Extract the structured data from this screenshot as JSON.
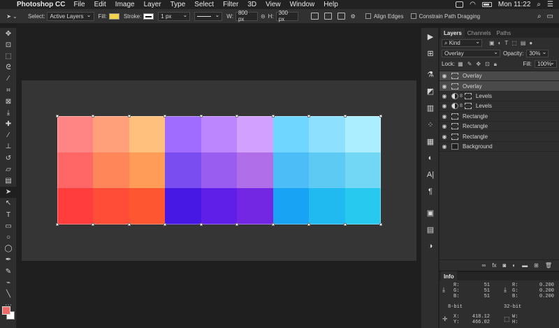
{
  "menubar": {
    "app_name": "Photoshop CC",
    "items": [
      "File",
      "Edit",
      "Image",
      "Layer",
      "Type",
      "Select",
      "Filter",
      "3D",
      "View",
      "Window",
      "Help"
    ],
    "clock": "Mon 11:22"
  },
  "options_bar": {
    "select_label": "Select:",
    "select_value": "Active Layers",
    "fill_label": "Fill:",
    "fill_color": "#f3d34a",
    "stroke_label": "Stroke:",
    "stroke_width": "1 px",
    "w_label": "W:",
    "w_value": "800 px",
    "h_label": "H:",
    "h_value": "300 px",
    "align_edges": "Align Edges",
    "constrain": "Constrain Path Dragging"
  },
  "colors": {
    "foreground": "#ee6b67",
    "background": "#ffffff",
    "swatches": [
      [
        "#ff8585",
        "#ffa07a",
        "#ffc07e",
        "#9f6cff",
        "#bb86ff",
        "#d2a0ff",
        "#6fd6ff",
        "#8ee0ff",
        "#aaeeff"
      ],
      [
        "#ff6767",
        "#ff8659",
        "#ff9d58",
        "#7a4df1",
        "#995ef0",
        "#b06ee9",
        "#4cbdf6",
        "#5dcaf4",
        "#71d7f5"
      ],
      [
        "#ff3d3d",
        "#ff4d37",
        "#ff5632",
        "#4718e4",
        "#601ee9",
        "#7427e3",
        "#18a3f4",
        "#20baf0",
        "#27c9ef"
      ]
    ]
  },
  "layers_panel": {
    "tabs": [
      "Layers",
      "Channels",
      "Paths"
    ],
    "filter_kind": "Kind",
    "blend_mode": "Overlay",
    "opacity_label": "Opacity:",
    "opacity_value": "30%",
    "lock_label": "Lock:",
    "fill_label": "Fill:",
    "fill_value": "100%",
    "layers": [
      {
        "name": "Overlay",
        "type": "shape",
        "selected": true
      },
      {
        "name": "Overlay",
        "type": "shape",
        "selected": true
      },
      {
        "name": "Levels",
        "type": "adjustment",
        "selected": false
      },
      {
        "name": "Levels",
        "type": "adjustment",
        "selected": false
      },
      {
        "name": "Rectangle",
        "type": "shape",
        "selected": false
      },
      {
        "name": "Rectangle",
        "type": "shape",
        "selected": false
      },
      {
        "name": "Rectangle",
        "type": "shape",
        "selected": false
      },
      {
        "name": "Background",
        "type": "background",
        "selected": false
      }
    ]
  },
  "info_panel": {
    "tab": "Info",
    "rgb_left": {
      "R": "51",
      "G": "51",
      "B": "51"
    },
    "rgb_right": {
      "R": "0.200",
      "G": "0.200",
      "B": "0.200"
    },
    "bit_left": "8-bit",
    "bit_right": "32-bit",
    "x_value": "418.12",
    "y_value": "466.02"
  }
}
